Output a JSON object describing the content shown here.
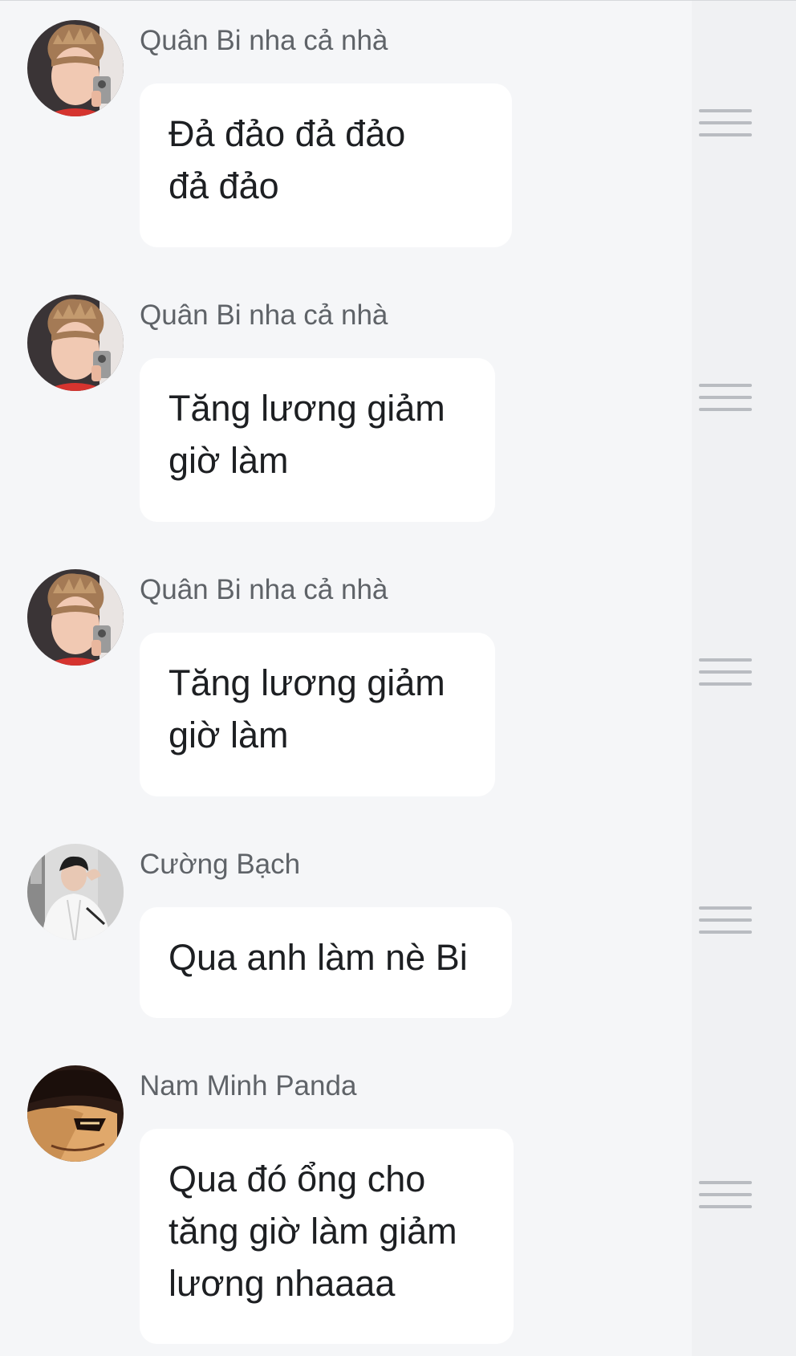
{
  "messages": [
    {
      "sender": "Quân Bi nha cả nhà",
      "avatar": "man-blond-mirror-selfie",
      "lines": [
        "Đả đảo đả đảo",
        "đả đảo"
      ]
    },
    {
      "sender": "Quân Bi nha cả nhà",
      "avatar": "man-blond-mirror-selfie",
      "lines": [
        "Tăng lương giảm",
        "giờ làm"
      ]
    },
    {
      "sender": "Quân Bi nha cả nhà",
      "avatar": "man-blond-mirror-selfie",
      "lines": [
        "Tăng lương giảm",
        "giờ làm"
      ]
    },
    {
      "sender": "Cường Bạch",
      "avatar": "man-white-jacket",
      "lines": [
        "Qua anh làm nè Bi"
      ]
    },
    {
      "sender": "Nam Minh Panda",
      "avatar": "anime-character-hat",
      "lines": [
        "Qua đó ổng cho",
        "tăng giờ làm giảm",
        "lương nhaaaa"
      ]
    }
  ],
  "icons": {
    "row_menu": "hamburger-menu-icon"
  },
  "colors": {
    "background": "#f5f6f8",
    "bubble": "#ffffff",
    "sender_text": "#5f6368",
    "message_text": "#1d1f22",
    "menu_icon": "#b9bcc1"
  }
}
